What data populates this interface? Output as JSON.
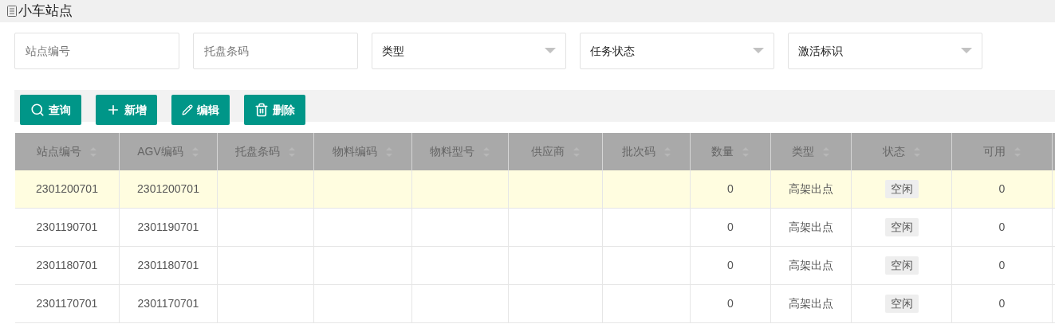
{
  "page_title": "小车站点",
  "filters": [
    {
      "kind": "input",
      "placeholder": "站点编号"
    },
    {
      "kind": "input",
      "placeholder": "托盘条码"
    },
    {
      "kind": "select",
      "value": "类型"
    },
    {
      "kind": "select",
      "value": "任务状态"
    },
    {
      "kind": "select",
      "value": "激活标识"
    }
  ],
  "toolbar": [
    {
      "kind": "search",
      "label": "查询"
    },
    {
      "kind": "add",
      "label": "新增"
    },
    {
      "kind": "edit",
      "label": "编辑"
    },
    {
      "kind": "delete",
      "label": "删除"
    }
  ],
  "table": {
    "columns": [
      "站点编号",
      "AGV编码",
      "托盘条码",
      "物料编码",
      "物料型号",
      "供应商",
      "批次码",
      "数量",
      "类型",
      "状态",
      "可用"
    ],
    "rows": [
      {
        "selected": true,
        "cells": [
          "2301200701",
          "2301200701",
          "",
          "",
          "",
          "",
          "",
          "0",
          "高架出点",
          "空闲",
          "0"
        ]
      },
      {
        "selected": false,
        "cells": [
          "2301190701",
          "2301190701",
          "",
          "",
          "",
          "",
          "",
          "0",
          "高架出点",
          "空闲",
          "0"
        ]
      },
      {
        "selected": false,
        "cells": [
          "2301180701",
          "2301180701",
          "",
          "",
          "",
          "",
          "",
          "0",
          "高架出点",
          "空闲",
          "0"
        ]
      },
      {
        "selected": false,
        "cells": [
          "2301170701",
          "2301170701",
          "",
          "",
          "",
          "",
          "",
          "0",
          "高架出点",
          "空闲",
          "0"
        ]
      }
    ]
  }
}
